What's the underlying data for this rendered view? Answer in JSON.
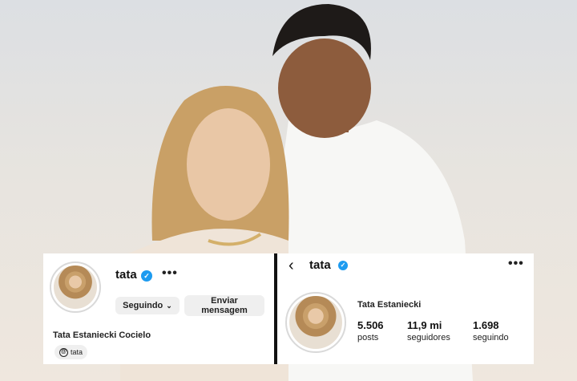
{
  "left_card": {
    "username": "tata",
    "verified_icon": "verified-badge-icon",
    "more_label": "•••",
    "follow_button": "Seguindo",
    "message_button_line1": "Enviar",
    "message_button_line2": "mensagem",
    "full_name": "Tata Estaniecki Cocielo",
    "threads_label": "tata"
  },
  "right_card": {
    "back_label": "‹",
    "username": "tata",
    "more_label": "•••",
    "full_name": "Tata Estaniecki",
    "stats": [
      {
        "value": "5.506",
        "label": "posts"
      },
      {
        "value": "11,9 mi",
        "label": "seguidores"
      },
      {
        "value": "1.698",
        "label": "seguindo"
      }
    ]
  },
  "colors": {
    "verified": "#1d9bf0",
    "card": "#ffffff",
    "button": "#efefef"
  }
}
